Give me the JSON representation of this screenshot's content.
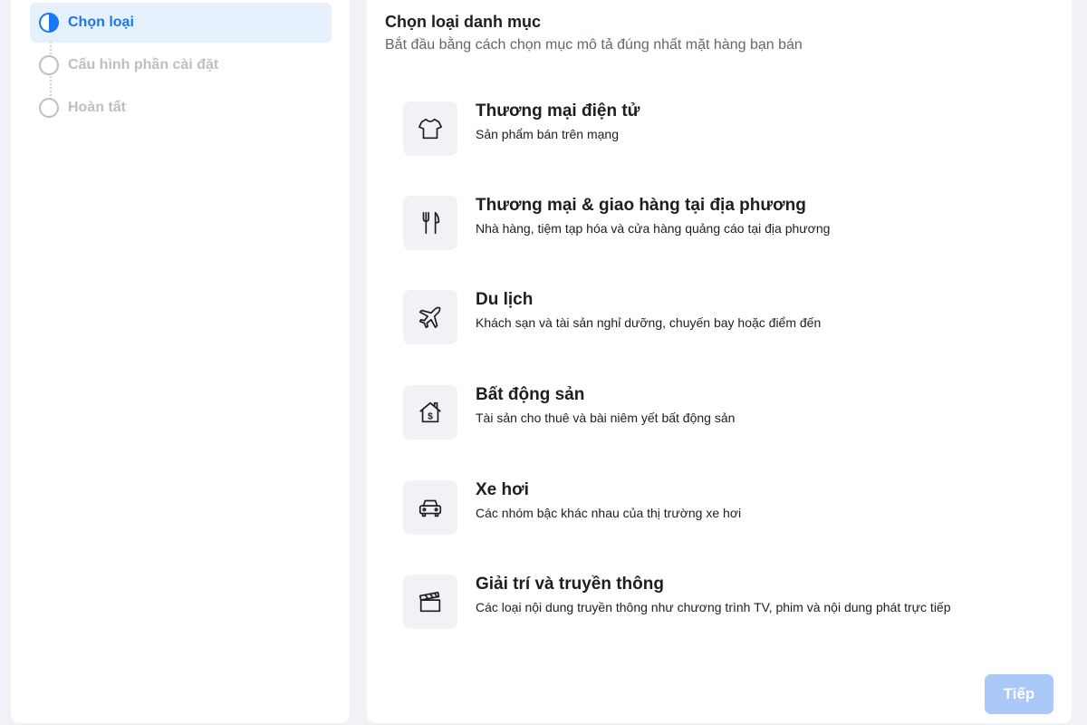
{
  "steps": [
    {
      "label": "Chọn loại",
      "state": "active"
    },
    {
      "label": "Cấu hình phần cài đặt",
      "state": "pending"
    },
    {
      "label": "Hoàn tất",
      "state": "pending"
    }
  ],
  "main": {
    "title": "Chọn loại danh mục",
    "subtitle": "Bắt đầu bằng cách chọn mục mô tả đúng nhất mặt hàng bạn bán",
    "categories": [
      {
        "icon": "shirt-icon",
        "title": "Thương mại điện tử",
        "desc": "Sản phẩm bán trên mạng"
      },
      {
        "icon": "fork-knife-icon",
        "title": "Thương mại & giao hàng tại địa phương",
        "desc": "Nhà hàng, tiệm tạp hóa và cửa hàng quảng cáo tại địa phương"
      },
      {
        "icon": "airplane-icon",
        "title": "Du lịch",
        "desc": "Khách sạn và tài sản nghỉ dưỡng, chuyến bay hoặc điểm đến"
      },
      {
        "icon": "house-dollar-icon",
        "title": "Bất động sản",
        "desc": "Tài sản cho thuê và bài niêm yết bất động sản"
      },
      {
        "icon": "car-icon",
        "title": "Xe hơi",
        "desc": "Các nhóm bậc khác nhau của thị trường xe hơi"
      },
      {
        "icon": "clapperboard-icon",
        "title": "Giải trí và truyền thông",
        "desc": "Các loại nội dung truyền thông như chương trình TV, phim và nội dung phát trực tiếp"
      }
    ],
    "next_label": "Tiếp"
  },
  "colors": {
    "accent": "#1877f2",
    "active_step_bg": "#e7f0fd",
    "disabled_button": "#aac9f9",
    "page_bg": "#f0f2f5"
  }
}
